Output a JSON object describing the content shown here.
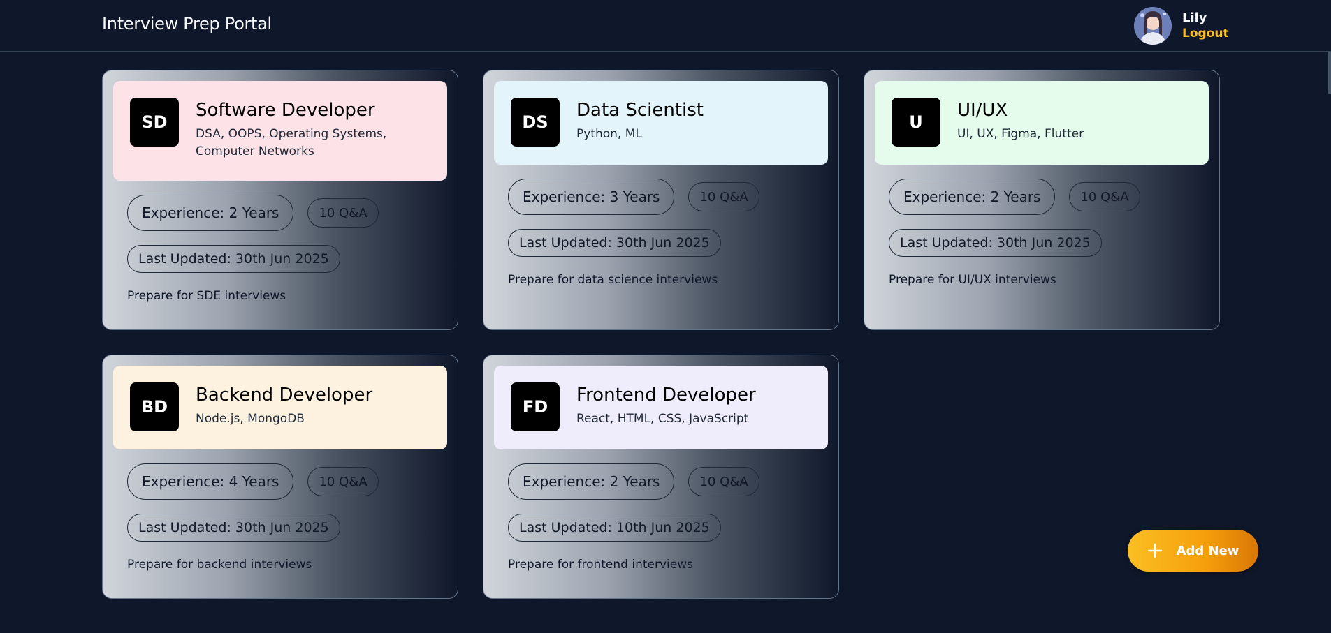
{
  "header": {
    "title": "Interview Prep Portal",
    "user_name": "Lily",
    "logout_label": "Logout"
  },
  "cards": [
    {
      "initials": "SD",
      "role": "Software Developer",
      "topics": "DSA, OOPS, Operating Systems, Computer Networks",
      "experience": "Experience: 2 Years",
      "qa": "10 Q&A",
      "updated": "Last Updated: 30th Jun 2025",
      "description": "Prepare for SDE interviews",
      "head_color": "#fde2e7"
    },
    {
      "initials": "DS",
      "role": "Data Scientist",
      "topics": "Python, ML",
      "experience": "Experience: 3 Years",
      "qa": "10 Q&A",
      "updated": "Last Updated: 30th Jun 2025",
      "description": "Prepare for data science interviews",
      "head_color": "#e3f5fb"
    },
    {
      "initials": "U",
      "role": "UI/UX",
      "topics": "UI, UX, Figma, Flutter",
      "experience": "Experience: 2 Years",
      "qa": "10 Q&A",
      "updated": "Last Updated: 30th Jun 2025",
      "description": "Prepare for UI/UX interviews",
      "head_color": "#e5fbeb"
    },
    {
      "initials": "BD",
      "role": "Backend Developer",
      "topics": "Node.js, MongoDB",
      "experience": "Experience: 4 Years",
      "qa": "10 Q&A",
      "updated": "Last Updated: 30th Jun 2025",
      "description": "Prepare for backend interviews",
      "head_color": "#fdf2df"
    },
    {
      "initials": "FD",
      "role": "Frontend Developer",
      "topics": "React, HTML, CSS, JavaScript",
      "experience": "Experience: 2 Years",
      "qa": "10 Q&A",
      "updated": "Last Updated: 10th Jun 2025",
      "description": "Prepare for frontend interviews",
      "head_color": "#efecfb"
    }
  ],
  "add_button": {
    "label": "Add New",
    "icon": "plus-icon"
  },
  "colors": {
    "background": "#0f172a",
    "accent": "#fbbf24"
  }
}
